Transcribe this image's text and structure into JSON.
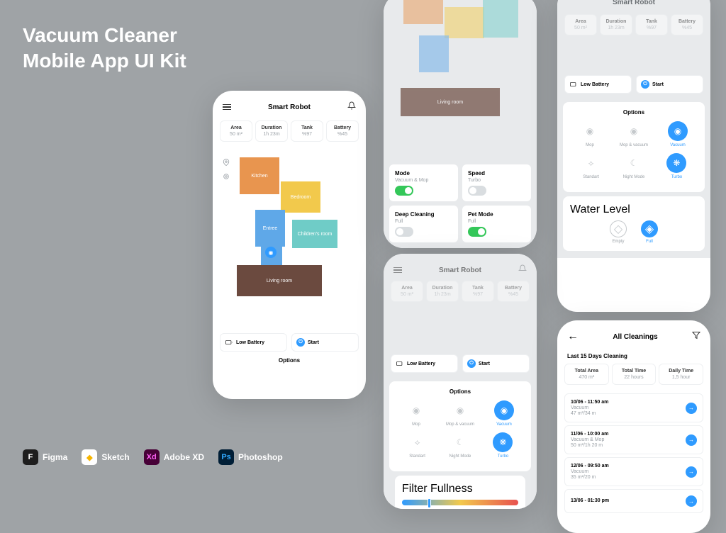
{
  "title_line1": "Vacuum Cleaner",
  "title_line2": "Mobile App UI Kit",
  "header": {
    "title": "Smart Robot"
  },
  "stats": [
    {
      "label": "Area",
      "value": "50 m²"
    },
    {
      "label": "Duration",
      "value": "1h 23m"
    },
    {
      "label": "Tank",
      "value": "%97"
    },
    {
      "label": "Battery",
      "value": "%45"
    }
  ],
  "rooms": {
    "kitchen": "Kitchen",
    "bedroom": "Bedroom",
    "entree": "Entree",
    "children": "Children's room",
    "living": "Living room"
  },
  "btns": {
    "low_battery": "Low Battery",
    "start": "Start"
  },
  "options_title": "Options",
  "modes": [
    {
      "label": "Mode",
      "value": "Vacuum & Mop",
      "on": true
    },
    {
      "label": "Speed",
      "value": "Turbo",
      "on": false
    },
    {
      "label": "Deep Cleaning",
      "value": "Full",
      "on": false
    },
    {
      "label": "Pet Mode",
      "value": "Full",
      "on": true
    }
  ],
  "opt_items_row1": [
    {
      "label": "Mop",
      "sel": false
    },
    {
      "label": "Mop & vacuum",
      "sel": false
    },
    {
      "label": "Vacuum",
      "sel": true
    }
  ],
  "opt_items_row2": [
    {
      "label": "Standart",
      "sel": false
    },
    {
      "label": "Night Mode",
      "sel": false
    },
    {
      "label": "Turbo",
      "sel": true
    }
  ],
  "water": {
    "title": "Water Level",
    "empty": "Empty",
    "full": "Full"
  },
  "filter_title": "Filter Fullness",
  "cleanings": {
    "title": "All Cleanings",
    "subtitle": "Last 15 Days Cleaning",
    "totals": [
      {
        "label": "Total Area",
        "value": "470 m²"
      },
      {
        "label": "Total Time",
        "value": "22 hours"
      },
      {
        "label": "Daily Time",
        "value": "1,5 hour"
      }
    ],
    "items": [
      {
        "time": "10/06 - 11:50 am",
        "mode": "Vacuum",
        "detail": "47 m²/34 m"
      },
      {
        "time": "11/06 - 10:00 am",
        "mode": "Vacuum & Mop",
        "detail": "50 m²/1h 20 m"
      },
      {
        "time": "12/06 - 09:50 am",
        "mode": "Vacuum",
        "detail": "35 m²/20 m"
      },
      {
        "time": "13/06 - 01:30 pm",
        "mode": "",
        "detail": ""
      }
    ]
  },
  "tools": [
    {
      "name": "Figma"
    },
    {
      "name": "Sketch"
    },
    {
      "name": "Adobe XD"
    },
    {
      "name": "Photoshop"
    }
  ]
}
